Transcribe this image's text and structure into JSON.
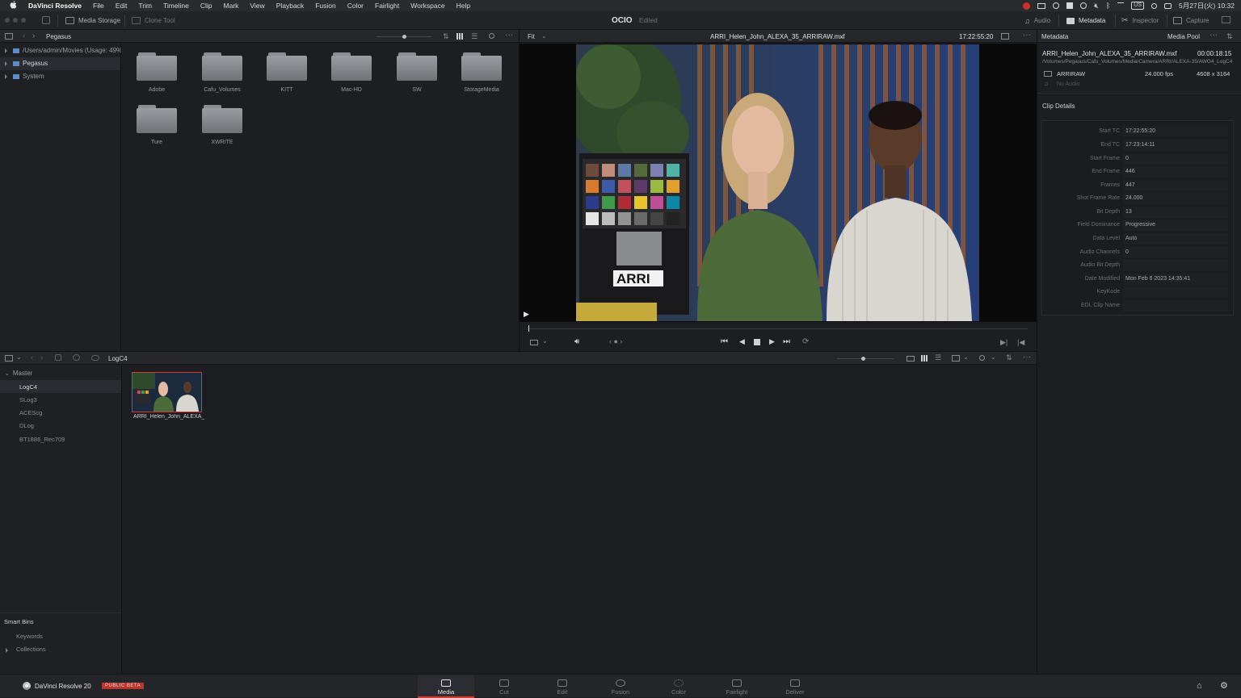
{
  "menubar": {
    "app": "DaVinci Resolve",
    "items": [
      "File",
      "Edit",
      "Trim",
      "Timeline",
      "Clip",
      "Mark",
      "View",
      "Playback",
      "Fusion",
      "Color",
      "Fairlight",
      "Workspace",
      "Help"
    ],
    "input_source": "US",
    "clock": "5月27日(火) 10:32"
  },
  "toolbar": {
    "media_storage": "Media Storage",
    "clone_tool": "Clone Tool",
    "project": "OCIO",
    "project_status": "Edited",
    "audio": "Audio",
    "metadata": "Metadata",
    "inspector": "Inspector",
    "capture": "Capture"
  },
  "storage": {
    "title": "Pegasus",
    "tree": [
      {
        "label": "/Users/admin/Movies (Usage: 49%)"
      },
      {
        "label": "Pegasus"
      },
      {
        "label": "System"
      }
    ],
    "folders": [
      "Adobe",
      "Cafu_Volumes",
      "KITT",
      "Mac-HD",
      "SW",
      "StorageMedia",
      "Ture",
      "XWRITE"
    ]
  },
  "viewer": {
    "zoom": "Fit",
    "clip_name": "ARRI_Helen_John_ALEXA_35_ARRIRAW.mxf",
    "timecode": "17:22:55:20"
  },
  "metadata": {
    "title": "Metadata",
    "media_pool": "Media Pool",
    "clip": "ARRI_Helen_John_ALEXA_35_ARRIRAW.mxf",
    "duration": "00:00:18:15",
    "path": "/Volumes/Pegasus/Cafu_Volumes/Media/Camera/ARRI/ALEXA-35/AWG4_LogC4",
    "codec": "ARRIRAW",
    "fps": "24.000 fps",
    "resolution": "4608 x 3164",
    "audio": "No Audio",
    "section": "Clip Details",
    "fields": [
      {
        "label": "Start TC",
        "value": "17:22:55:20"
      },
      {
        "label": "End TC",
        "value": "17:23:14:11"
      },
      {
        "label": "Start Frame",
        "value": "0"
      },
      {
        "label": "End Frame",
        "value": "446"
      },
      {
        "label": "Frames",
        "value": "447"
      },
      {
        "label": "Shot Frame Rate",
        "value": "24.000"
      },
      {
        "label": "Bit Depth",
        "value": "13"
      },
      {
        "label": "Field Dominance",
        "value": "Progressive"
      },
      {
        "label": "Data Level",
        "value": "Auto"
      },
      {
        "label": "Audio Channels",
        "value": "0"
      },
      {
        "label": "Audio Bit Depth",
        "value": ""
      },
      {
        "label": "Date Modified",
        "value": "Mon Feb 6 2023 14:35:41"
      },
      {
        "label": "KeyKode",
        "value": ""
      },
      {
        "label": "EDL Clip Name",
        "value": ""
      }
    ]
  },
  "mediapool": {
    "current_bin": "LogC4",
    "master": "Master",
    "bins": [
      "LogC4",
      "SLog3",
      "ACEScg",
      "DLog",
      "BT1886_Rec709"
    ],
    "clip_label": "ARRI_Helen_John_ALEXA_...",
    "smart_bins": "Smart Bins",
    "smart_items": [
      "Keywords",
      "Collections"
    ]
  },
  "bottom": {
    "product": "DaVinci Resolve 20",
    "badge": "PUBLIC BETA",
    "pages": [
      "Media",
      "Cut",
      "Edit",
      "Fusion",
      "Color",
      "Fairlight",
      "Deliver"
    ],
    "active_page": "Media"
  },
  "colors": {
    "accent_red": "#d8392d",
    "panel_bg": "#1d1e21",
    "header_bg": "#26272b"
  },
  "icons": [
    "apple-icon",
    "window-controls-icon",
    "sidebar-toggle-icon",
    "search-icon",
    "more-icon",
    "play-icon",
    "stop-icon",
    "volume-icon",
    "home-icon",
    "gear-icon",
    "folder-icon"
  ]
}
